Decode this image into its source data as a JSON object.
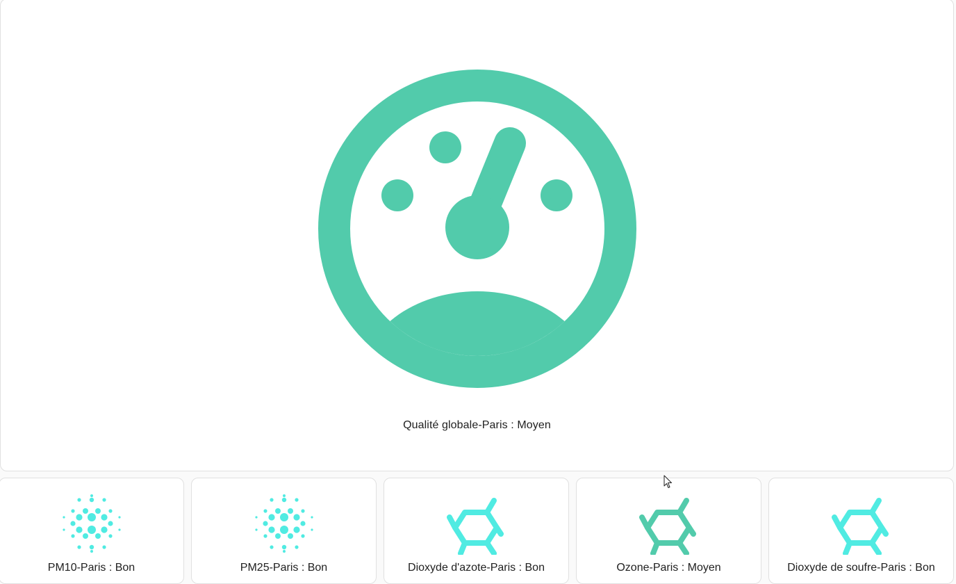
{
  "colors": {
    "gauge": "#52cbab",
    "particles": "#50ebe2",
    "molecule_good": "#50ebe2",
    "molecule_medium": "#52cbab"
  },
  "main": {
    "icon": "gauge-icon",
    "label": "Qualité globale-Paris : Moyen"
  },
  "sensors": [
    {
      "icon": "particles-icon",
      "label": "PM10-Paris : Bon"
    },
    {
      "icon": "particles-icon",
      "label": "PM25-Paris : Bon"
    },
    {
      "icon": "molecule-icon",
      "label": "Dioxyde d'azote-Paris : Bon"
    },
    {
      "icon": "molecule-icon",
      "label": "Ozone-Paris : Moyen"
    },
    {
      "icon": "molecule-icon",
      "label": "Dioxyde de soufre-Paris : Bon"
    }
  ]
}
